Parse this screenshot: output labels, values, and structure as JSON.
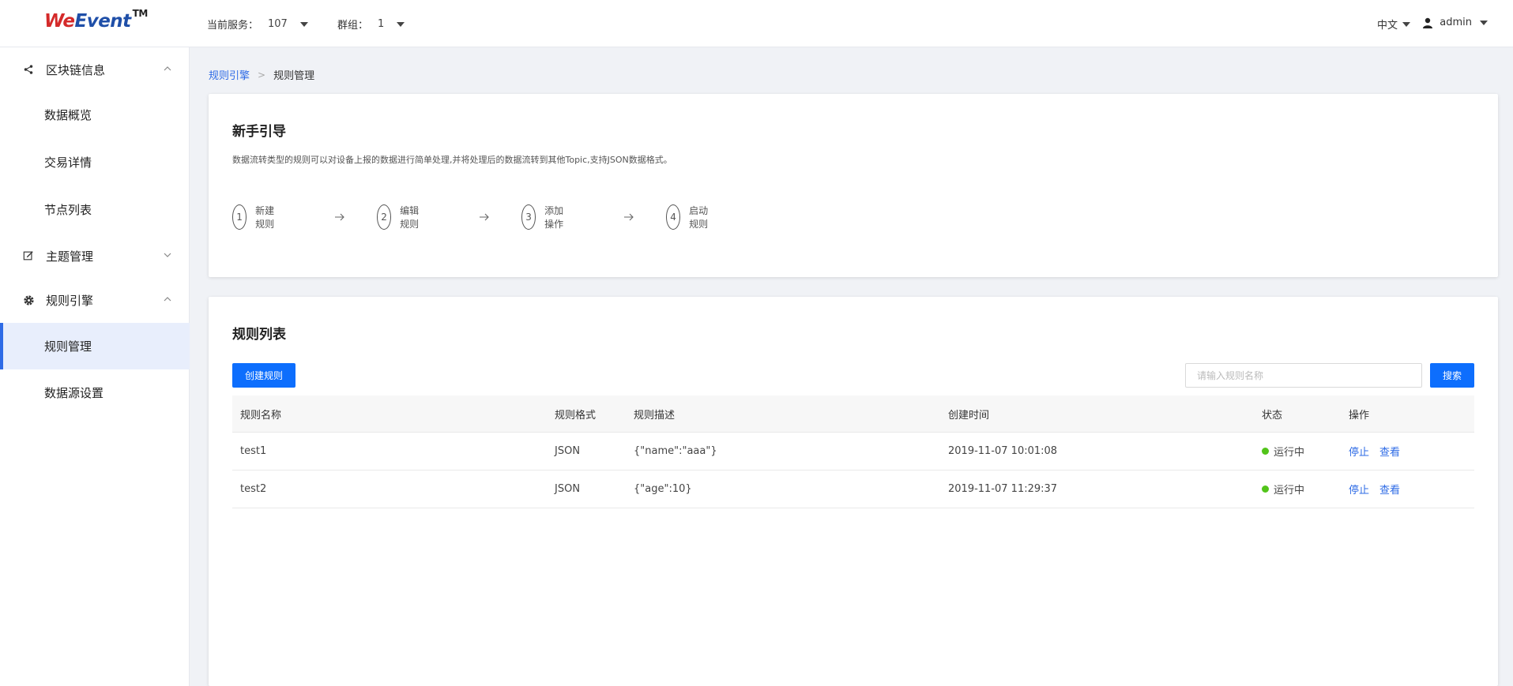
{
  "header": {
    "logo_we": "We",
    "logo_event": "Event",
    "logo_tm": "TM",
    "service_label": "当前服务：",
    "service_value": "107",
    "group_label": "群组：",
    "group_value": "1",
    "language": "中文",
    "user": "admin"
  },
  "sidebar": {
    "groups": [
      {
        "label": "区块链信息",
        "icon": "share-icon",
        "expanded": true
      },
      {
        "label": "主题管理",
        "icon": "edit-icon",
        "expanded": false
      },
      {
        "label": "规则引擎",
        "icon": "gear-icon",
        "expanded": true
      }
    ],
    "items": [
      {
        "label": "数据概览"
      },
      {
        "label": "交易详情"
      },
      {
        "label": "节点列表"
      },
      {
        "label": "规则管理",
        "active": true
      },
      {
        "label": "数据源设置"
      }
    ]
  },
  "breadcrumb": {
    "parent": "规则引擎",
    "separator": ">",
    "current": "规则管理"
  },
  "guide": {
    "title": "新手引导",
    "description": "数据流转类型的规则可以对设备上报的数据进行简单处理,并将处理后的数据流转到其他Topic,支持JSON数据格式。",
    "steps": [
      {
        "number": "1",
        "label": "新建规则"
      },
      {
        "number": "2",
        "label": "编辑规则"
      },
      {
        "number": "3",
        "label": "添加操作"
      },
      {
        "number": "4",
        "label": "启动规则"
      }
    ]
  },
  "rules": {
    "title": "规则列表",
    "create_button": "创建规则",
    "search_placeholder": "请输入规则名称",
    "search_button": "搜索",
    "columns": [
      "规则名称",
      "规则格式",
      "规则描述",
      "创建时间",
      "状态",
      "操作"
    ],
    "rows": [
      {
        "name": "test1",
        "format": "JSON",
        "description": "{\"name\":\"aaa\"}",
        "created": "2019-11-07 10:01:08",
        "status": "运行中",
        "action_stop": "停止",
        "action_view": "查看"
      },
      {
        "name": "test2",
        "format": "JSON",
        "description": "{\"age\":10}",
        "created": "2019-11-07 11:29:37",
        "status": "运行中",
        "action_stop": "停止",
        "action_view": "查看"
      }
    ]
  },
  "colors": {
    "primary": "#0d6efd",
    "link": "#2e6be6",
    "status_running": "#52c41a",
    "active_menu_bg": "#e8eefc"
  }
}
